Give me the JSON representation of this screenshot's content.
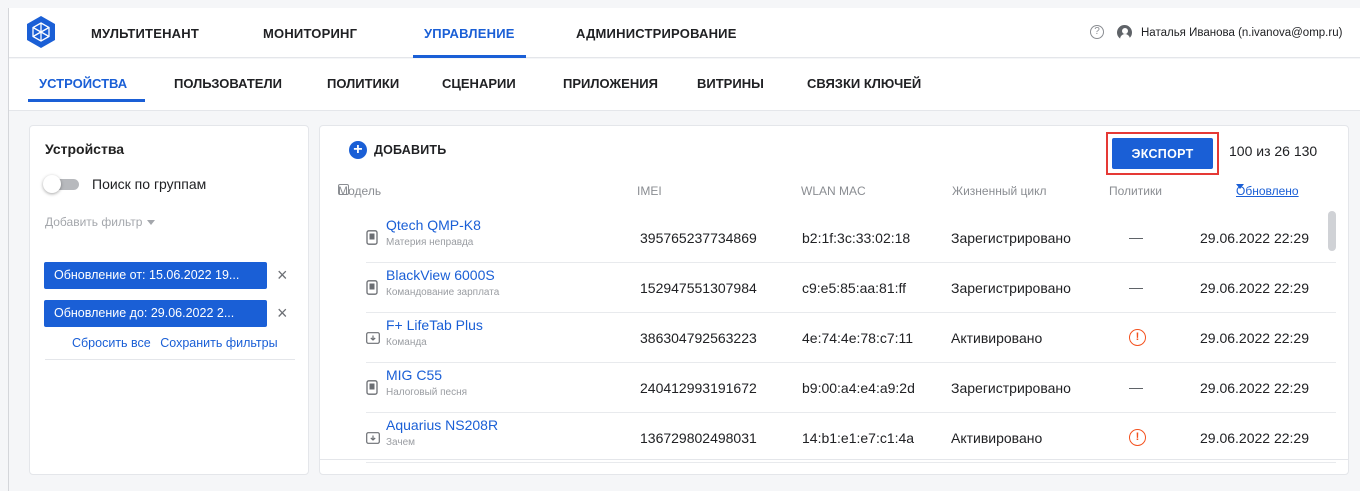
{
  "topnav": {
    "items": [
      "МУЛЬТИТЕНАНТ",
      "МОНИТОРИНГ",
      "УПРАВЛЕНИЕ",
      "АДМИНИСТРИРОВАНИЕ"
    ],
    "active": "УПРАВЛЕНИЕ",
    "help_glyph": "?",
    "user": "Наталья Иванова (n.ivanova@omp.ru)"
  },
  "subnav": {
    "items": [
      "УСТРОЙСТВА",
      "ПОЛЬЗОВАТЕЛИ",
      "ПОЛИТИКИ",
      "СЦЕНАРИИ",
      "ПРИЛОЖЕНИЯ",
      "ВИТРИНЫ",
      "СВЯЗКИ КЛЮЧЕЙ"
    ],
    "active": "УСТРОЙСТВА"
  },
  "sidebar": {
    "title": "Устройства",
    "group_search_label": "Поиск по группам",
    "group_search_on": false,
    "add_filter": "Добавить фильтр",
    "filters": [
      "Обновление от: 15.06.2022 19...",
      "Обновление до: 29.06.2022 2..."
    ],
    "reset_all": "Сбросить все",
    "save_filters": "Сохранить фильтры"
  },
  "toolbar": {
    "add_label": "ДОБАВИТЬ",
    "export_label": "ЭКСПОРТ",
    "count": "100 из 26 130"
  },
  "table": {
    "columns": {
      "model": "Модель",
      "imei": "IMEI",
      "wlan": "WLAN MAC",
      "lifecycle": "Жизненный цикл",
      "policies": "Политики",
      "updated": "Обновлено"
    },
    "rows": [
      {
        "type": "phone",
        "model": "Qtech QMP-K8",
        "owner": "Материя неправда",
        "imei": "395765237734869",
        "wlan": "b2:1f:3c:33:02:18",
        "lifecycle": "Зарегистрировано",
        "policy": "none",
        "updated": "29.06.2022 22:29"
      },
      {
        "type": "phone",
        "model": "BlackView 6000S",
        "owner": "Командование зарплата",
        "imei": "152947551307984",
        "wlan": "c9:e5:85:aa:81:ff",
        "lifecycle": "Зарегистрировано",
        "policy": "none",
        "updated": "29.06.2022 22:29"
      },
      {
        "type": "tablet",
        "model": "F+ LifeTab Plus",
        "owner": "Команда",
        "imei": "386304792563223",
        "wlan": "4e:74:4e:78:c7:11",
        "lifecycle": "Активировано",
        "policy": "warning",
        "updated": "29.06.2022 22:29"
      },
      {
        "type": "phone",
        "model": "MIG C55",
        "owner": "Налоговый песня",
        "imei": "240412993191672",
        "wlan": "b9:00:a4:e4:a9:2d",
        "lifecycle": "Зарегистрировано",
        "policy": "none",
        "updated": "29.06.2022 22:29"
      },
      {
        "type": "tablet",
        "model": "Aquarius NS208R",
        "owner": "Зачем",
        "imei": "136729802498031",
        "wlan": "14:b1:e1:e7:c1:4a",
        "lifecycle": "Активировано",
        "policy": "warning",
        "updated": "29.06.2022 22:29"
      }
    ]
  },
  "colors": {
    "accent": "#1a5fd6",
    "warning": "#f4511e",
    "highlight": "#e53935"
  }
}
